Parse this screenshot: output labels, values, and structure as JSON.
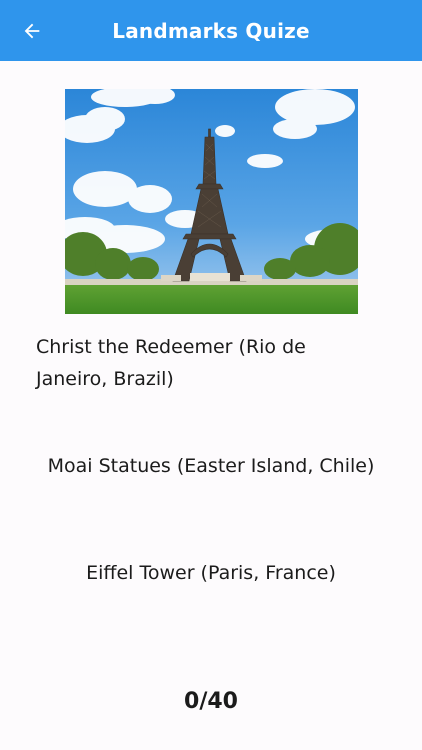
{
  "app_bar": {
    "title": "Landmarks Quize",
    "back_icon": "arrow-left-icon",
    "background_color": "#2f95ec"
  },
  "question": {
    "image_subject": "eiffel-tower-photo"
  },
  "options": [
    {
      "label": "Christ the Redeemer (Rio de Janeiro, Brazil)"
    },
    {
      "label": "Moai Statues (Easter Island, Chile)"
    },
    {
      "label": "Eiffel Tower (Paris, France)"
    }
  ],
  "score": {
    "text": "0/40"
  }
}
